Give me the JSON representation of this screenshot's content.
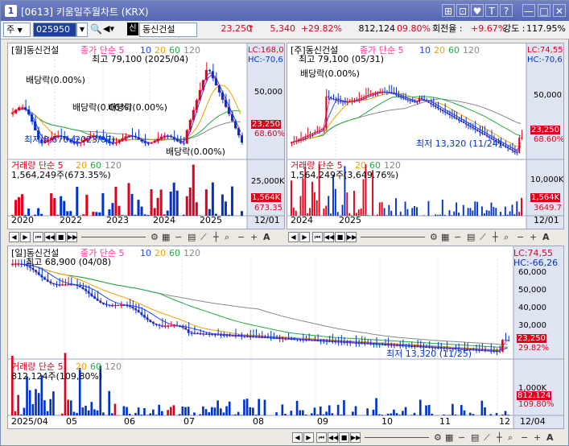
{
  "window": {
    "num": "1",
    "title": "[0613] 키움일주월차트 (KRX)",
    "buttons": [
      "⊞",
      "⊡",
      "♥",
      "T",
      "?",
      "—",
      "□",
      "✕"
    ]
  },
  "toolbar": {
    "market": "주",
    "code": "025950",
    "badge": "신",
    "name": "동신건설",
    "price": "23,250",
    "change": "5,340",
    "change_pct": "+29.82%",
    "volume": "812,124",
    "vol_pct": "09.80%",
    "turnover_label": "회전율 :",
    "turnover": "+9.67%",
    "strength_label": "강도 :",
    "strength": "117.95%"
  },
  "charts": {
    "monthly": {
      "header": "[월]동신건설",
      "legend_price": "종가 단순 5",
      "ma": [
        "10",
        "20",
        "60",
        "120"
      ],
      "lc": "LC:168,0",
      "hc": "HC:-70,6",
      "high_note": "최고 79,100 (2025/04)",
      "low_note": "최저 8,670 (2023/07)",
      "div_notes": [
        "배당락(0.00%)",
        "배당락(0.00%)",
        "배당락(0.00%)",
        "배당락(0.00%)"
      ],
      "price_scale": [
        "50,000"
      ],
      "price_tag": "23,250",
      "price_pct": "68.60%",
      "vol_header": "거래량 단순 5",
      "vol_ma": [
        "20",
        "60",
        "120"
      ],
      "vol_value": "1,564,249주(673.35%)",
      "vol_scale": [
        "25,000K"
      ],
      "vol_tag": "1,564K",
      "vol_pct": "673.35",
      "x_labels": [
        "2020",
        "2022",
        "2023",
        "2024",
        "2025"
      ],
      "date_tag": "12/01"
    },
    "weekly": {
      "header": "[주]동신건설",
      "legend_price": "종가 단순 5",
      "ma": [
        "10",
        "20",
        "60",
        "120"
      ],
      "lc": "LC:74,55",
      "hc": "HC:-70,6",
      "high_note": "최고 79,100 (05/31)",
      "low_note": "최저 13,320 (11/24)",
      "div_notes": [
        "배당락(0.00%)"
      ],
      "price_scale": [
        "50,000"
      ],
      "price_tag": "23,250",
      "price_pct": "68.60%",
      "vol_header": "거래량 단순 5",
      "vol_ma": [
        "20",
        "60",
        "120"
      ],
      "vol_value": "1,564,249주(3,649.76%)",
      "vol_scale": [
        "10,000K"
      ],
      "vol_tag": "1,564K",
      "vol_pct": "3649.7",
      "x_labels": [
        "2024",
        "2025"
      ],
      "date_tag": "12/01"
    },
    "daily": {
      "header": "[일]동신건설",
      "legend_price": "종가 단순 5",
      "ma": [
        "10",
        "20",
        "60",
        "120"
      ],
      "lc": "LC:74,55",
      "hc": "HC:-66,26",
      "high_note": "최고 68,900 (04/08)",
      "low_note": "최저 13,320 (11/25)",
      "price_scale": [
        "60,000",
        "50,000",
        "40,000",
        "30,000"
      ],
      "price_tag": "23,250",
      "price_pct": "29.82%",
      "vol_header": "거래량 단순 5",
      "vol_ma": [
        "20",
        "60",
        "120"
      ],
      "vol_value": "812,124주(109,80%)",
      "vol_scale": [
        "1,000K"
      ],
      "vol_tag": "812,124",
      "vol_pct": "109.80%",
      "x_labels": [
        "2025/04",
        "05",
        "06",
        "07",
        "08",
        "09",
        "10",
        "11",
        "12"
      ],
      "date_tag": "12/04"
    }
  },
  "colors": {
    "up": "#e0001b",
    "down": "#0033cc",
    "ma5": "#ff3399",
    "ma10": "#2244ff",
    "ma20": "#f0a000",
    "ma60": "#22aa44",
    "ma120": "#888888",
    "scale_bg": "#dfe4f2"
  },
  "icons": [
    "arrow-left-icon",
    "first-icon",
    "prev-icon",
    "stop-icon",
    "next-icon",
    "slider-icon",
    "settings-icon",
    "grid-icon",
    "indicator-icon",
    "crosshair-icon",
    "zoom-icon",
    "minus-icon",
    "plus-icon",
    "text-icon"
  ]
}
